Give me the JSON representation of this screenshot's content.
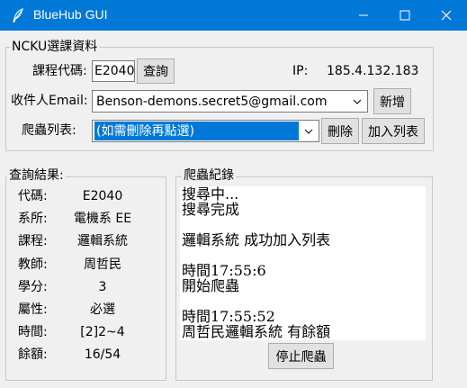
{
  "window": {
    "title": "BlueHub GUI"
  },
  "ncku": {
    "group_title": "NCKU選課資料",
    "course_code_label": "課程代碼:",
    "course_code_value": "E2040",
    "query_button": "查詢",
    "ip_label": "IP:",
    "ip_value": "185.4.132.183",
    "email_label": "收件人Email:",
    "email_value": "Benson-demons.secret5@gmail.com",
    "add_button": "新增",
    "crawler_label": "爬蟲列表:",
    "crawler_selected": "(如需刪除再點選)",
    "delete_button": "刪除",
    "add_to_list_button": "加入列表"
  },
  "results": {
    "group_title": "查詢結果:",
    "rows": [
      {
        "label": "代碼:",
        "value": "E2040"
      },
      {
        "label": "系所:",
        "value": "電機系 EE"
      },
      {
        "label": "課程:",
        "value": "邏輯系統"
      },
      {
        "label": "教師:",
        "value": "周哲民"
      },
      {
        "label": "學分:",
        "value": "3"
      },
      {
        "label": "屬性:",
        "value": "必選"
      },
      {
        "label": "時間:",
        "value": "[2]2~4"
      },
      {
        "label": "餘額:",
        "value": "16/54"
      }
    ]
  },
  "log": {
    "group_title": "爬蟲紀錄",
    "lines": [
      "搜尋中...",
      "搜尋完成",
      "",
      "邏輯系統  成功加入列表",
      "",
      "時間17:55:6",
      "開始爬蟲",
      "",
      "時間17:55:52",
      "周哲民邏輯系統  有餘額"
    ],
    "stop_button": "停止爬蟲"
  }
}
